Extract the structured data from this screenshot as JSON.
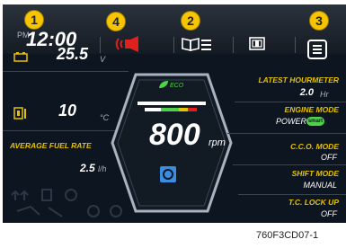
{
  "callouts": [
    "1",
    "2",
    "3",
    "4"
  ],
  "topbar": {
    "ampm": "PM",
    "time": "12:00"
  },
  "left": {
    "battery_value": "25.5",
    "battery_unit": "V",
    "temp_value": "10",
    "temp_unit": "°C",
    "fuel_label": "AVERAGE FUEL RATE",
    "fuel_value": "2.5",
    "fuel_unit": "l/h"
  },
  "center": {
    "eco_label": "ECO",
    "rpm_value": "800",
    "rpm_unit": "rpm",
    "q_label": "Q"
  },
  "right": {
    "hourmeter_label": "LATEST HOURMETER",
    "hourmeter_value": "2.0",
    "hourmeter_unit": "Hr",
    "engine_mode_label": "ENGINE MODE",
    "engine_mode_value": "POWER",
    "smart_badge": "smart",
    "cco_label": "C.C.O. MODE",
    "cco_value": "OFF",
    "shift_label": "SHIFT MODE",
    "shift_value": "MANUAL",
    "tc_label": "T.C. LOCK UP",
    "tc_value": "OFF"
  },
  "caption": "760F3CD07-1",
  "colors": {
    "accent_yellow": "#e6c200",
    "eco_green": "#4fd24a",
    "alert_red": "#e0201d",
    "q_blue": "#3a8de0"
  },
  "icons": [
    "alarm-horn-icon",
    "manual-book-icon",
    "camera-view-icon",
    "menu-icon",
    "battery-icon",
    "coolant-temp-icon"
  ]
}
